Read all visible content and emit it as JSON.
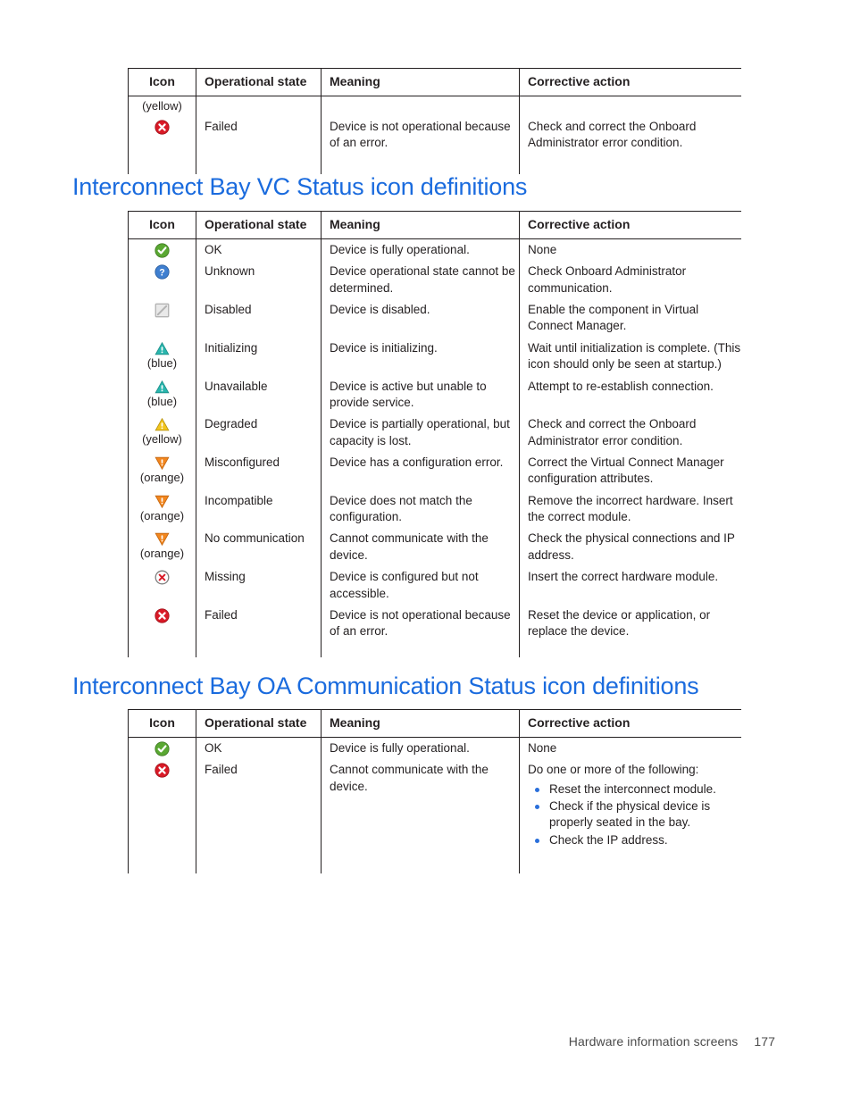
{
  "page": {
    "footer_text": "Hardware information screens",
    "page_number": "177",
    "heading_color": "#1a6bde"
  },
  "columns": [
    "Icon",
    "Operational state",
    "Meaning",
    "Corrective action"
  ],
  "table_top": {
    "carryover_note": "(yellow)",
    "rows": [
      {
        "icon": "failed-red-circle-x-icon",
        "color_note": "",
        "state": "Failed",
        "meaning": "Device is not operational because of an error.",
        "corrective": "Check and correct the Onboard Administrator error condition."
      }
    ]
  },
  "section_vc": {
    "heading": "Interconnect Bay VC Status icon definitions",
    "rows": [
      {
        "icon": "ok-green-circle-check-icon",
        "color_note": "",
        "state": "OK",
        "meaning": "Device is fully operational.",
        "corrective": "None"
      },
      {
        "icon": "unknown-blue-circle-question-icon",
        "color_note": "",
        "state": "Unknown",
        "meaning": "Device operational state cannot be determined.",
        "corrective": "Check Onboard Administrator communication."
      },
      {
        "icon": "disabled-gray-square-slash-icon",
        "color_note": "",
        "state": "Disabled",
        "meaning": "Device is disabled.",
        "corrective": "Enable the component in Virtual Connect Manager."
      },
      {
        "icon": "initializing-blue-triangle-warning-icon",
        "color_note": "(blue)",
        "state": "Initializing",
        "meaning": "Device is initializing.",
        "corrective": "Wait until initialization is complete. (This icon should only be seen at startup.)"
      },
      {
        "icon": "unavailable-blue-triangle-warning-icon",
        "color_note": "(blue)",
        "state": "Unavailable",
        "meaning": "Device is active but unable to provide service.",
        "corrective": "Attempt to re-establish connection."
      },
      {
        "icon": "degraded-yellow-triangle-warning-icon",
        "color_note": "(yellow)",
        "state": "Degraded",
        "meaning": "Device is partially operational, but capacity is lost.",
        "corrective": "Check and correct the Onboard Administrator error condition."
      },
      {
        "icon": "misconfigured-orange-inverted-triangle-icon",
        "color_note": "(orange)",
        "state": "Misconfigured",
        "meaning": "Device has a configuration error.",
        "corrective": "Correct the Virtual Connect Manager configuration attributes."
      },
      {
        "icon": "incompatible-orange-inverted-triangle-icon",
        "color_note": "(orange)",
        "state": "Incompatible",
        "meaning": "Device does not match the configuration.",
        "corrective": "Remove the incorrect hardware. Insert the correct module."
      },
      {
        "icon": "no-communication-orange-inverted-triangle-icon",
        "color_note": "(orange)",
        "state": "No communication",
        "meaning": "Cannot communicate with the device.",
        "corrective": "Check the physical connections and IP address."
      },
      {
        "icon": "missing-outlined-circle-x-icon",
        "color_note": "",
        "state": "Missing",
        "meaning": "Device is configured but not accessible.",
        "corrective": "Insert the correct hardware module."
      },
      {
        "icon": "failed-red-circle-x-icon",
        "color_note": "",
        "state": "Failed",
        "meaning": "Device is not operational because of an error.",
        "corrective": "Reset the device or application, or replace the device."
      }
    ]
  },
  "section_oa": {
    "heading": "Interconnect Bay OA Communication Status icon definitions",
    "rows": [
      {
        "icon": "ok-green-circle-check-icon",
        "color_note": "",
        "state": "OK",
        "meaning": "Device is fully operational.",
        "corrective": "None",
        "bullets": []
      },
      {
        "icon": "failed-red-circle-x-icon",
        "color_note": "",
        "state": "Failed",
        "meaning": "Cannot communicate with the device.",
        "corrective": "Do one or more of the following:",
        "bullets": [
          "Reset the interconnect module.",
          "Check if the physical device is properly seated in the bay.",
          "Check the IP address."
        ]
      }
    ]
  },
  "icon_colors": {
    "ok_green": "#5aa832",
    "unknown_blue": "#3f7fd0",
    "disabled_gray": "#b3b3b3",
    "warning_blue": "#29b6ae",
    "warning_yellow": "#f2c41d",
    "orange": "#f2861e",
    "failed_red": "#d91a27",
    "missing_gray": "#7d7d7d",
    "bullet_blue": "#2a6fdb"
  }
}
